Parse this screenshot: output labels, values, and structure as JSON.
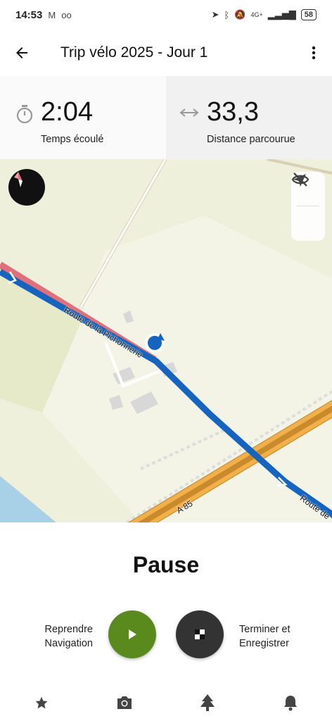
{
  "status_bar": {
    "time": "14:53",
    "left_icons": [
      "gmail-icon",
      "voicemail-icon"
    ],
    "right_icons": [
      "location-icon",
      "bluetooth-icon",
      "mute-icon",
      "signal-icon"
    ],
    "network": "4G+",
    "battery": "58"
  },
  "app_bar": {
    "title": "Trip vélo 2025 - Jour 1"
  },
  "stats": {
    "time_value": "2:04",
    "time_label": "Temps écoulé",
    "distance_value": "33,3",
    "distance_label": "Distance parcourue"
  },
  "map": {
    "road_name_1": "Route de la Pichonnerie",
    "road_name_2": "Route de",
    "highway_label": "A 85",
    "colors": {
      "background": "#eef0dc",
      "route": "#1565c0",
      "traveled": "#e2707a",
      "highway": "#e8a33a"
    }
  },
  "pause": {
    "title": "Pause",
    "resume_label_line1": "Reprendre",
    "resume_label_line2": "Navigation",
    "finish_label_line1": "Terminer et",
    "finish_label_line2": "Enregistrer"
  },
  "colors": {
    "play_button": "#5a8a1e",
    "stop_button": "#333333"
  },
  "bottom_nav": [
    "star-icon",
    "camera-icon",
    "tree-icon",
    "bell-icon"
  ]
}
